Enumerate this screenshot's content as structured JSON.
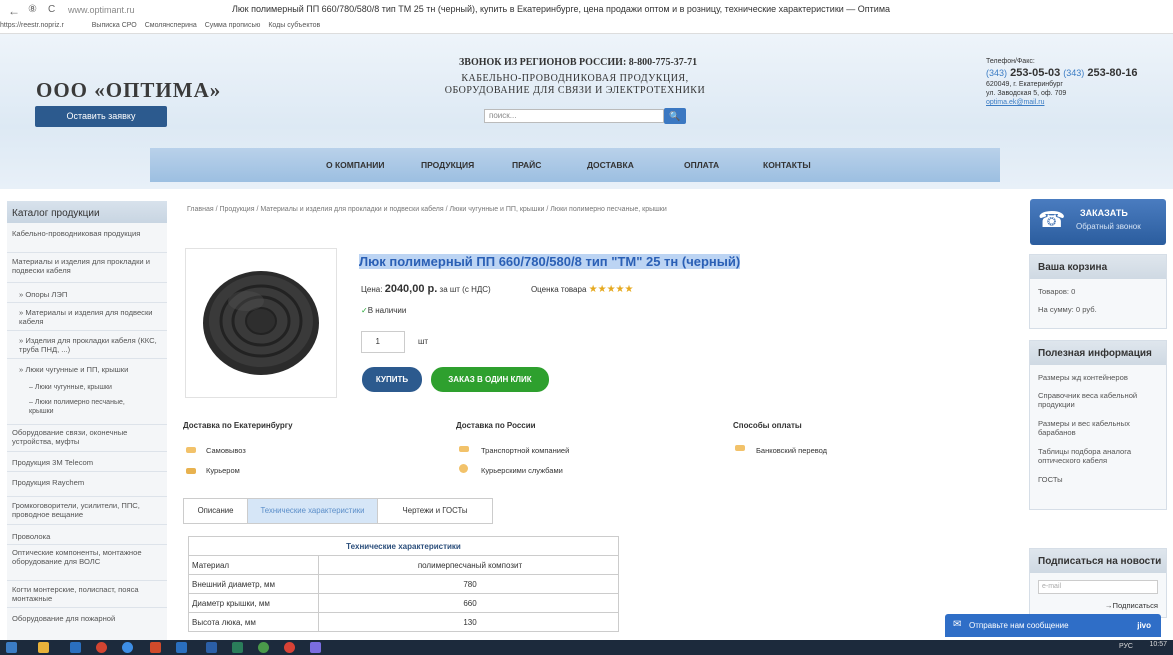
{
  "browser": {
    "url": "www.optimant.ru",
    "tab_title": "Люк полимерный ПП 660/780/580/8 тип ТМ 25 тн (черный), купить в Екатеринбурге, цена продажи оптом и в розницу, технические характеристики — Оптима",
    "back": "←",
    "reload": "C",
    "home": "⑧"
  },
  "bookmarks": [
    "https://reestr.nopriz.r",
    "Выписка СРО",
    "Смолянсперина",
    "Сумма прописью",
    "Коды субъектов"
  ],
  "header": {
    "logo": "ООО «ОПТИМА»",
    "order_button": "Оставить заявку",
    "phone_region": "ЗВОНОК ИЗ РЕГИОНОВ РОССИИ: 8-800-775-37-71",
    "tagline_1": "КАБЕЛЬНО-ПРОВОДНИКОВАЯ ПРОДУКЦИЯ,",
    "tagline_2": "ОБОРУДОВАНИЕ ДЛЯ СВЯЗИ И ЭЛЕКТРОТЕХНИКИ",
    "search_placeholder": "поиск...",
    "search_icon": "magnifier-icon"
  },
  "contacts": {
    "label": "Телефон/Факс:",
    "code1": "(343)",
    "phone1": "253-05-03",
    "code2": "(343)",
    "phone2": "253-80-16",
    "addr1": "620049, г. Екатеринбург",
    "addr2": "ул. Заводская 5, оф. 709",
    "email": "optima.ek@mail.ru"
  },
  "menu": [
    "О КОМПАНИИ",
    "ПРОДУКЦИЯ",
    "ПРАЙС",
    "ДОСТАВКА",
    "ОПЛАТА",
    "КОНТАКТЫ"
  ],
  "sidebar": {
    "title": "Каталог продукции",
    "items": [
      "Кабельно-проводниковая продукция",
      "Материалы и изделия для прокладки и подвески кабеля",
      "Опоры ЛЭП",
      "Материалы и изделия для подвески кабеля",
      "Изделия для прокладки кабеля (ККС, труба ПНД, ...)",
      "Люки чугунные и ПП, крышки",
      "Люки чугунные, крышки",
      "Люки полимерно песчаные, крышки",
      "Оборудование связи, оконечные устройства, муфты",
      "Продукция 3М Telecom",
      "Продукция Raychem",
      "Громкоговорители, усилители, ППС, проводное вещание",
      "Проволока",
      "Оптические компоненты, монтажное оборудование для ВОЛС",
      "Когти монтерские, полиспаст, пояса монтажные",
      "Оборудование для пожарной"
    ]
  },
  "breadcrumbs": "Главная / Продукция / Материалы и изделия для прокладки и подвески кабеля / Люки чугунные и ПП, крышки / Люки полимерно песчаные, крышки",
  "product": {
    "title": "Люк полимерный ПП 660/780/580/8 тип \"ТМ\" 25 тн (черный)",
    "price_label": "Цена:",
    "price": "2040,00 р.",
    "price_unit": "за шт (с НДС)",
    "rating_label": "Оценка товара",
    "stars": "★★★★★",
    "stock": "В наличии",
    "qty": "1",
    "qty_unit": "шт",
    "buy": "КУПИТЬ",
    "oneclick": "ЗАКАЗ В ОДИН КЛИК"
  },
  "delivery": {
    "local_title": "Доставка по Екатеринбургу",
    "local": [
      "Самовывоз",
      "Курьером"
    ],
    "russia_title": "Доставка по России",
    "russia": [
      "Транспортной компанией",
      "Курьерскими службами"
    ],
    "pay_title": "Способы оплаты",
    "pay": [
      "Банковский перевод"
    ]
  },
  "tabs": [
    "Описание",
    "Технические характеристики",
    "Чертежи и ГОСТы"
  ],
  "specs": {
    "header": "Технические характеристики",
    "rows": [
      [
        "Материал",
        "полимерпесчаный композит"
      ],
      [
        "Внешний диаметр, мм",
        "780"
      ],
      [
        "Диаметр крышки, мм",
        "660"
      ],
      [
        "Высота люка, мм",
        "130"
      ]
    ]
  },
  "right": {
    "call_title": "ЗАКАЗАТЬ",
    "call_sub": "Обратный звонок",
    "cart_title": "Ваша корзина",
    "cart_items": "Товаров: 0",
    "cart_sum": "На сумму: 0 руб.",
    "info_title": "Полезная информация",
    "info": [
      "Размеры жд контейнеров",
      "Справочник веса кабельной продукции",
      "Размеры и вес кабельных барабанов",
      "Таблицы подбора аналога оптического кабеля",
      "ГОСТы"
    ],
    "news_title": "Подписаться на новости",
    "email_placeholder": "e-mail",
    "subscribe": "Подписаться"
  },
  "chat": {
    "text": "Отправьте нам сообщение",
    "brand": "jivo"
  },
  "taskbar": {
    "time": "10:57",
    "lang": "РУС"
  },
  "colors": {
    "link": "#2a5fb5",
    "button_blue": "#2c5a8e",
    "button_green": "#2ea02e",
    "star": "#e6a91f"
  }
}
